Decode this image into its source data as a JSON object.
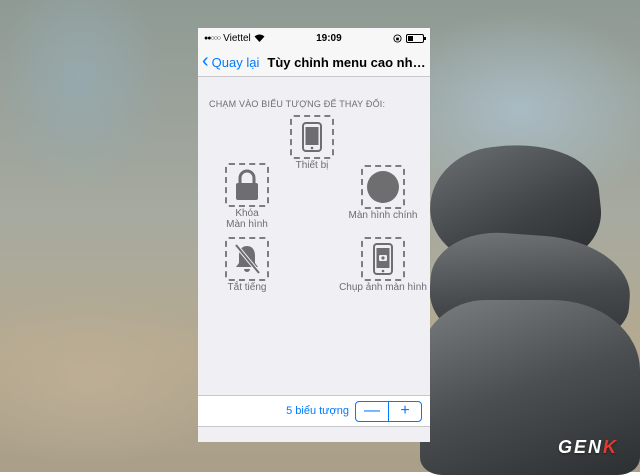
{
  "status_bar": {
    "carrier": "Viettel",
    "signal": "●●○○○",
    "time": "19:09",
    "battery_level": 0.35
  },
  "nav": {
    "back_label": "Quay lại",
    "title": "Tùy chỉnh menu cao nhất..."
  },
  "section_header": "CHẠM VÀO BIỂU TƯỢNG ĐỂ THAY ĐỔI:",
  "icons": {
    "device": {
      "label": "Thiết bị"
    },
    "lock": {
      "label_line1": "Khóa",
      "label_line2": "Màn hình"
    },
    "home": {
      "label": "Màn hình chính"
    },
    "mute": {
      "label": "Tắt tiếng"
    },
    "screenshot": {
      "label": "Chụp ảnh màn hình"
    }
  },
  "footer": {
    "count_label": "5 biểu tượng",
    "minus": "—",
    "plus": "+"
  },
  "watermark": {
    "prefix": "GEN",
    "suffix": "K"
  },
  "colors": {
    "accent": "#007aff",
    "icon": "#6e6e70"
  }
}
